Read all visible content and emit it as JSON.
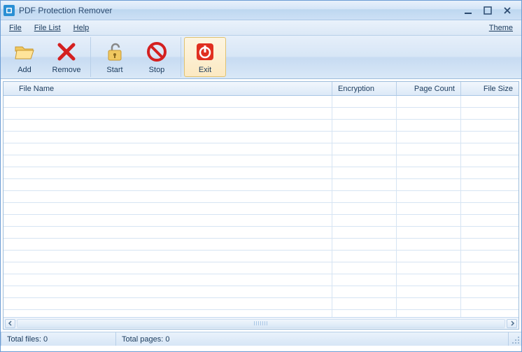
{
  "window": {
    "title": "PDF Protection Remover"
  },
  "menu": {
    "file": "File",
    "filelist": "File List",
    "help": "Help",
    "theme": "Theme"
  },
  "toolbar": {
    "add": "Add",
    "remove": "Remove",
    "start": "Start",
    "stop": "Stop",
    "exit": "Exit"
  },
  "columns": {
    "filename": "File Name",
    "encryption": "Encryption",
    "pagecount": "Page Count",
    "filesize": "File Size"
  },
  "status": {
    "total_files": "Total files: 0",
    "total_pages": "Total pages: 0"
  },
  "rows": []
}
